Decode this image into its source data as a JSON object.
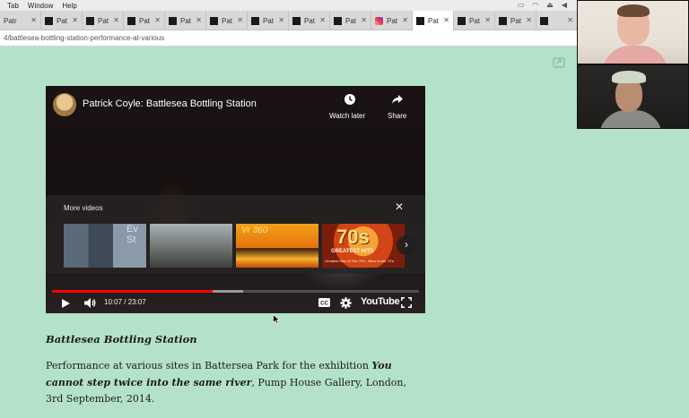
{
  "menubar": {
    "items": [
      "Tab",
      "Window",
      "Help"
    ]
  },
  "tabs": [
    {
      "label": "Patr",
      "favicon": "none",
      "active": false
    },
    {
      "label": "Pat",
      "favicon": "black-square",
      "active": false
    },
    {
      "label": "Pat",
      "favicon": "black-square",
      "active": false
    },
    {
      "label": "Pat",
      "favicon": "black-square",
      "active": false
    },
    {
      "label": "Pat",
      "favicon": "black-square",
      "active": false
    },
    {
      "label": "Pat",
      "favicon": "black-square",
      "active": false
    },
    {
      "label": "Pat",
      "favicon": "black-square",
      "active": false
    },
    {
      "label": "Pat",
      "favicon": "black-square",
      "active": false
    },
    {
      "label": "Pat",
      "favicon": "black-square",
      "active": false
    },
    {
      "label": "Pat",
      "favicon": "instagram",
      "active": false
    },
    {
      "label": "Pat",
      "favicon": "black-square",
      "active": true
    },
    {
      "label": "Pat",
      "favicon": "black-square",
      "active": false
    },
    {
      "label": "Pat",
      "favicon": "black-square",
      "active": false
    },
    {
      "label": "",
      "favicon": "black-square",
      "active": false
    }
  ],
  "address": {
    "url": "4/battlesea-bottling-station-performance-at-various"
  },
  "video": {
    "title": "Patrick Coyle: Battlesea Bottling Station",
    "watch_later": "Watch later",
    "share": "Share",
    "more_videos": "More videos",
    "thumb1_text": "Ev\nSt",
    "thumb3_text": "Vr 360",
    "thumb4_big": "70s",
    "thumb4_sub1": "GREATEST HITS",
    "thumb4_sub2": "Greatest Hits Of The 70's - Back to the 70's",
    "time": "10:07 / 23:07",
    "progress_played": 0.437,
    "progress_buffered": 0.52,
    "logo": "YouTube",
    "colors": {
      "played": "#ff0000",
      "bg": "#0f0b0c"
    }
  },
  "article": {
    "title": "Battlesea Bottling Station",
    "body_pre": "Performance at various sites in Battersea Park for the exhibition ",
    "body_bold": "You cannot step twice into the same river",
    "body_post": ", Pump House Gallery, London, 3rd September, 2014."
  },
  "page": {
    "background": "#b4e2c8"
  }
}
